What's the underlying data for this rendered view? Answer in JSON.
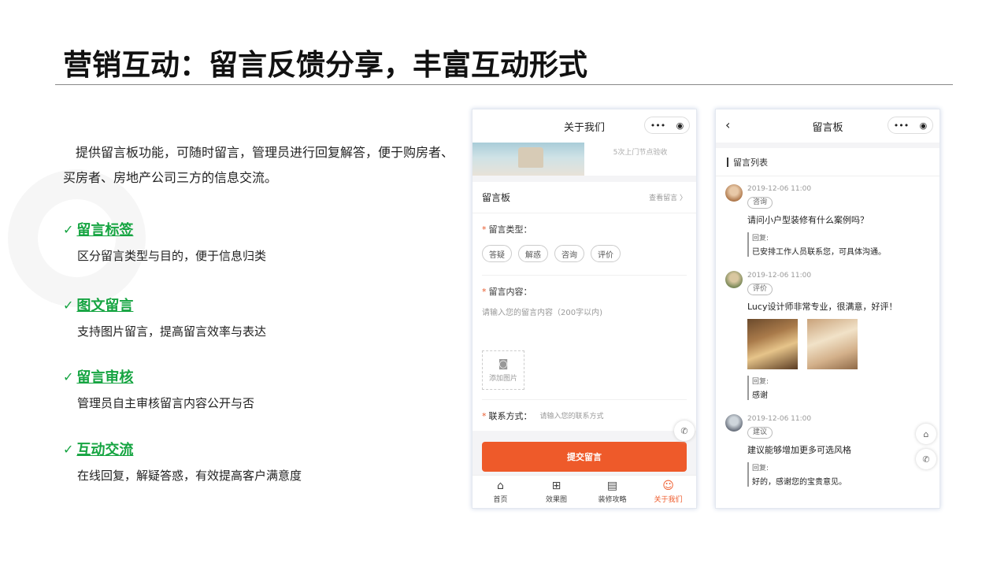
{
  "slide": {
    "title": "营销互动：留言反馈分享，丰富互动形式",
    "intro": "提供留言板功能，可随时留言，管理员进行回复解答，便于购房者、买房者、房地产公司三方的信息交流。",
    "features": [
      {
        "title": "留言标签",
        "desc": "区分留言类型与目的，便于信息归类"
      },
      {
        "title": "图文留言",
        "desc": "支持图片留言，提高留言效率与表达"
      },
      {
        "title": "留言审核",
        "desc": "管理员自主审核留言内容公开与否"
      },
      {
        "title": "互动交流",
        "desc": "在线回复，解疑答惑，有效提高客户满意度"
      }
    ],
    "accent_color": "#15a441",
    "check_icon": "✓"
  },
  "phone1": {
    "nav_title": "关于我们",
    "banner_text": "5次上门节点验收",
    "board_title": "留言板",
    "board_more": "查看留言 〉",
    "type_label": "留言类型：",
    "types": [
      "答疑",
      "解惑",
      "咨询",
      "评价"
    ],
    "content_label": "留言内容：",
    "content_placeholder": "请输入您的留言内容（200字以内)",
    "add_photo": "添加图片",
    "contact_label": "联系方式：",
    "contact_placeholder": "请输入您的联系方式",
    "submit": "提交留言",
    "tabs": [
      "首页",
      "效果图",
      "装修攻略",
      "关于我们"
    ],
    "submit_color": "#ee5a2a"
  },
  "phone2": {
    "nav_title": "留言板",
    "list_title": "留言列表",
    "reply_label": "回复:",
    "messages": [
      {
        "date": "2019-12-06 11:00",
        "tag": "咨询",
        "content": "请问小户型装修有什么案例吗？",
        "reply": "已安排工作人员联系您，可具体沟通。"
      },
      {
        "date": "2019-12-06 11:00",
        "tag": "评价",
        "content": "Lucy设计师非常专业，很满意，好评！",
        "reply": "感谢"
      },
      {
        "date": "2019-12-06 11:00",
        "tag": "建议",
        "content": "建议能够增加更多可选风格",
        "reply": "好的，感谢您的宝贵意见。"
      }
    ]
  }
}
